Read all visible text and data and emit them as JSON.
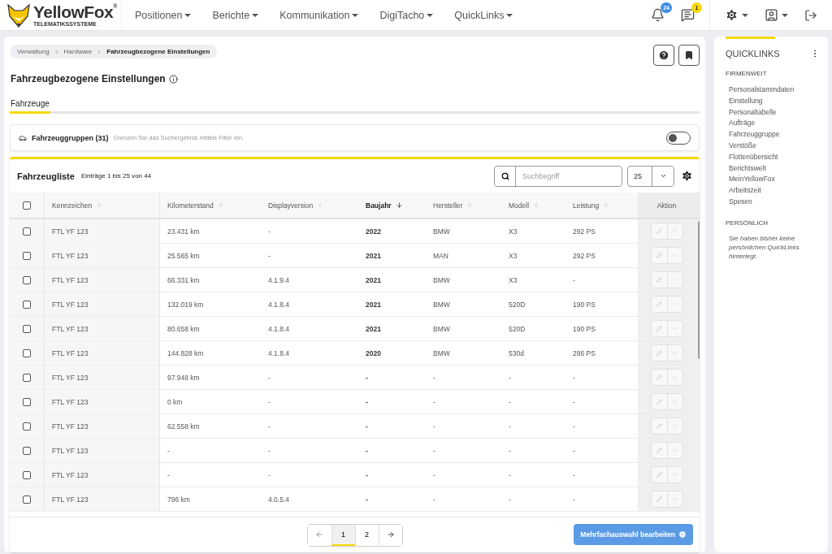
{
  "brand": {
    "name": "YellowFox",
    "registered": "®",
    "tagline": "TELEMATIKSSYSTEME"
  },
  "nav": [
    {
      "label": "Positionen"
    },
    {
      "label": "Berichte"
    },
    {
      "label": "Kommunikation"
    },
    {
      "label": "DigiTacho"
    },
    {
      "label": "QuickLinks"
    }
  ],
  "notifications": [
    {
      "kind": "bell",
      "count": "24",
      "color": "#3d8ee8"
    },
    {
      "kind": "message",
      "count": "1",
      "color": "#f5d90a"
    }
  ],
  "breadcrumbs": [
    {
      "label": "Verwaltung",
      "current": false
    },
    {
      "label": "Hardware",
      "current": false
    },
    {
      "label": "Fahrzeugbezogene Einstellungen",
      "current": true
    }
  ],
  "page_title": "Fahrzeugbezogene Einstellungen",
  "tabs": [
    {
      "label": "Fahrzeuge",
      "selected": true
    }
  ],
  "filter": {
    "label": "Fahrzeuggruppen (31)",
    "hint": "Grenzen Sie das Suchergebnis mittels Filter ein.",
    "on": false
  },
  "list": {
    "title": "Fahrzeugliste",
    "summary": "Einträge 1 bis 25 von 44",
    "search_placeholder": "Suchbegriff",
    "page_size": "25",
    "select_all_checked": false,
    "columns": [
      {
        "label": "Kennzeichen",
        "sorted": false
      },
      {
        "label": "Kilometerstand",
        "sorted": false
      },
      {
        "label": "Displayversion",
        "sorted": false
      },
      {
        "label": "Baujahr",
        "sorted": true
      },
      {
        "label": "Hersteller",
        "sorted": false
      },
      {
        "label": "Modell",
        "sorted": false
      },
      {
        "label": "Leistung",
        "sorted": false
      }
    ],
    "action_column": "Aktion",
    "rows": [
      {
        "checked": false,
        "cells": [
          "FTL YF 123",
          "23.431 km",
          "-",
          "2022",
          "BMW",
          "X3",
          "292 PS"
        ]
      },
      {
        "checked": false,
        "cells": [
          "FTL YF 123",
          "25.565 km",
          "-",
          "2021",
          "MAN",
          "X3",
          "292 PS"
        ]
      },
      {
        "checked": false,
        "cells": [
          "FTL YF 123",
          "66.331 km",
          "4.1.9.4",
          "2021",
          "BMW",
          "X3",
          "-"
        ]
      },
      {
        "checked": false,
        "cells": [
          "FTL YF 123",
          "132.019 km",
          "4.1.8.4",
          "2021",
          "BMW",
          "520D",
          "190 PS"
        ]
      },
      {
        "checked": false,
        "cells": [
          "FTL YF 123",
          "80.658 km",
          "4.1.8.4",
          "2021",
          "BMW",
          "520D",
          "190 PS"
        ]
      },
      {
        "checked": false,
        "cells": [
          "FTL YF 123",
          "144.828 km",
          "4.1.8.4",
          "2020",
          "BMW",
          "530d",
          "286 PS"
        ]
      },
      {
        "checked": false,
        "cells": [
          "FTL YF 123",
          "97.948 km",
          "-",
          "-",
          "-",
          "-",
          "-"
        ]
      },
      {
        "checked": false,
        "cells": [
          "FTL YF 123",
          "0 km",
          "-",
          "-",
          "-",
          "-",
          "-"
        ]
      },
      {
        "checked": false,
        "cells": [
          "FTL YF 123",
          "62.558 km",
          "-",
          "-",
          "-",
          "-",
          "-"
        ]
      },
      {
        "checked": false,
        "cells": [
          "FTL YF 123",
          "-",
          "-",
          "-",
          "-",
          "-",
          "-"
        ]
      },
      {
        "checked": false,
        "cells": [
          "FTL YF 123",
          "-",
          "-",
          "-",
          "-",
          "-",
          "-"
        ]
      },
      {
        "checked": false,
        "cells": [
          "FTL YF 123",
          "796 km",
          "4.0.5.4",
          "-",
          "-",
          "-",
          "-"
        ]
      }
    ],
    "pages": [
      {
        "label": "1",
        "selected": true
      },
      {
        "label": "2",
        "selected": false
      }
    ],
    "bulk_button": "Mehrfachauswahl bearbeiten"
  },
  "quicklinks": {
    "title": "QUICKLINKS",
    "sections": [
      {
        "heading": "FIRMENWEIT",
        "links": [
          "Personalstammdaten",
          "Einstellung",
          "Personaltabelle",
          "Aufträge",
          "Fahrzeuggruppe",
          "Verstöße",
          "Flottenübersicht",
          "Berichtswelt",
          "MeinYellowFox",
          "Arbeitszeit",
          "Spesen"
        ]
      },
      {
        "heading": "PERSÖNLICH",
        "empty_text": "Sie haben bisher keine persönlichen QuickLinks hinterlegt."
      }
    ]
  }
}
